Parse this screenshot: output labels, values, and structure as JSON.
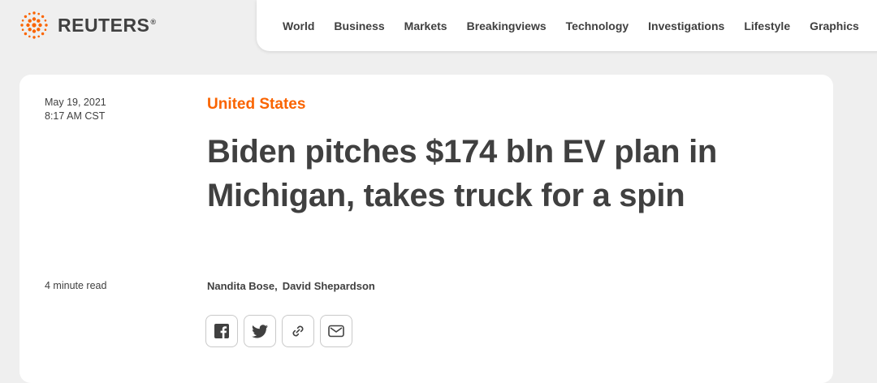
{
  "header": {
    "brand": "REUTERS",
    "brand_mark": "®",
    "nav": [
      "World",
      "Business",
      "Markets",
      "Breakingviews",
      "Technology",
      "Investigations",
      "Lifestyle",
      "Graphics"
    ]
  },
  "article": {
    "date": "May 19, 2021",
    "time": "8:17 AM CST",
    "section": "United States",
    "headline": "Biden pitches $174 bln EV plan in Michigan, takes truck for a spin",
    "read_time": "4 minute read",
    "authors": [
      "Nandita Bose,",
      "David Shepardson"
    ]
  },
  "share": {
    "icons": [
      "facebook-icon",
      "twitter-icon",
      "link-icon",
      "email-icon"
    ]
  },
  "colors": {
    "accent": "#fa6400",
    "text": "#404040",
    "page_bg": "#efefef",
    "card_bg": "#ffffff"
  }
}
